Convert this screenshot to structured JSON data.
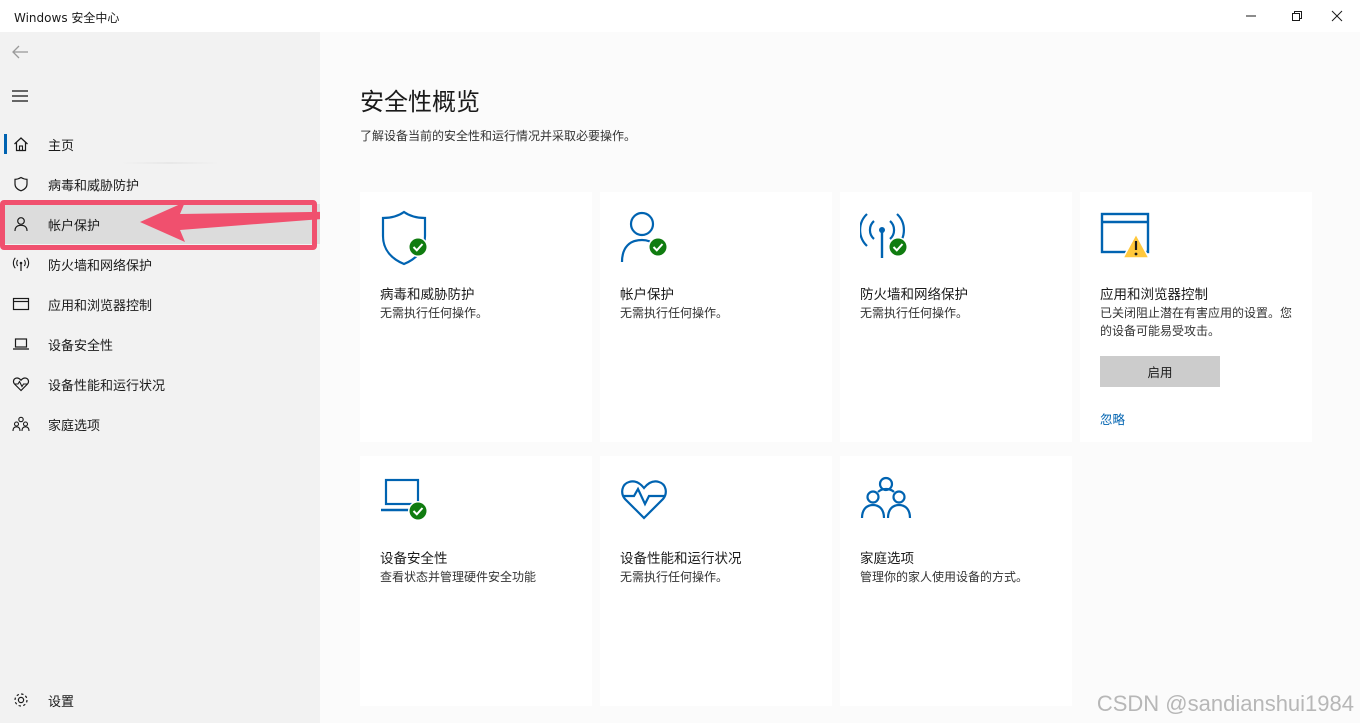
{
  "window": {
    "title": "Windows 安全中心"
  },
  "sidebar": {
    "items": [
      {
        "label": "主页",
        "icon": "home-icon"
      },
      {
        "label": "病毒和威胁防护",
        "icon": "shield-icon"
      },
      {
        "label": "帐户保护",
        "icon": "person-icon"
      },
      {
        "label": "防火墙和网络保护",
        "icon": "antenna-icon"
      },
      {
        "label": "应用和浏览器控制",
        "icon": "browser-window-icon"
      },
      {
        "label": "设备安全性",
        "icon": "laptop-icon"
      },
      {
        "label": "设备性能和运行状况",
        "icon": "heart-icon"
      },
      {
        "label": "家庭选项",
        "icon": "family-icon"
      }
    ],
    "settings_label": "设置"
  },
  "main": {
    "title": "安全性概览",
    "description": "了解设备当前的安全性和运行情况并采取必要操作。",
    "cards": [
      {
        "title": "病毒和威胁防护",
        "desc": "无需执行任何操作。",
        "icon": "shield-check-icon"
      },
      {
        "title": "帐户保护",
        "desc": "无需执行任何操作。",
        "icon": "person-check-icon"
      },
      {
        "title": "防火墙和网络保护",
        "desc": "无需执行任何操作。",
        "icon": "antenna-check-icon"
      },
      {
        "title": "应用和浏览器控制",
        "desc": "已关闭阻止潜在有害应用的设置。您的设备可能易受攻击。",
        "icon": "browser-warning-icon",
        "button": "启用",
        "link": "忽略"
      },
      {
        "title": "设备安全性",
        "desc": "查看状态并管理硬件安全功能",
        "icon": "laptop-check-icon"
      },
      {
        "title": "设备性能和运行状况",
        "desc": "无需执行任何操作。",
        "icon": "heart-pulse-icon"
      },
      {
        "title": "家庭选项",
        "desc": "管理你的家人使用设备的方式。",
        "icon": "family-icon"
      }
    ]
  },
  "watermark": "CSDN @sandianshui1984",
  "colors": {
    "accent": "#0063b1",
    "ok_green": "#107c10",
    "warning_yellow": "#ffc83d",
    "highlight_red": "#f0506e"
  }
}
